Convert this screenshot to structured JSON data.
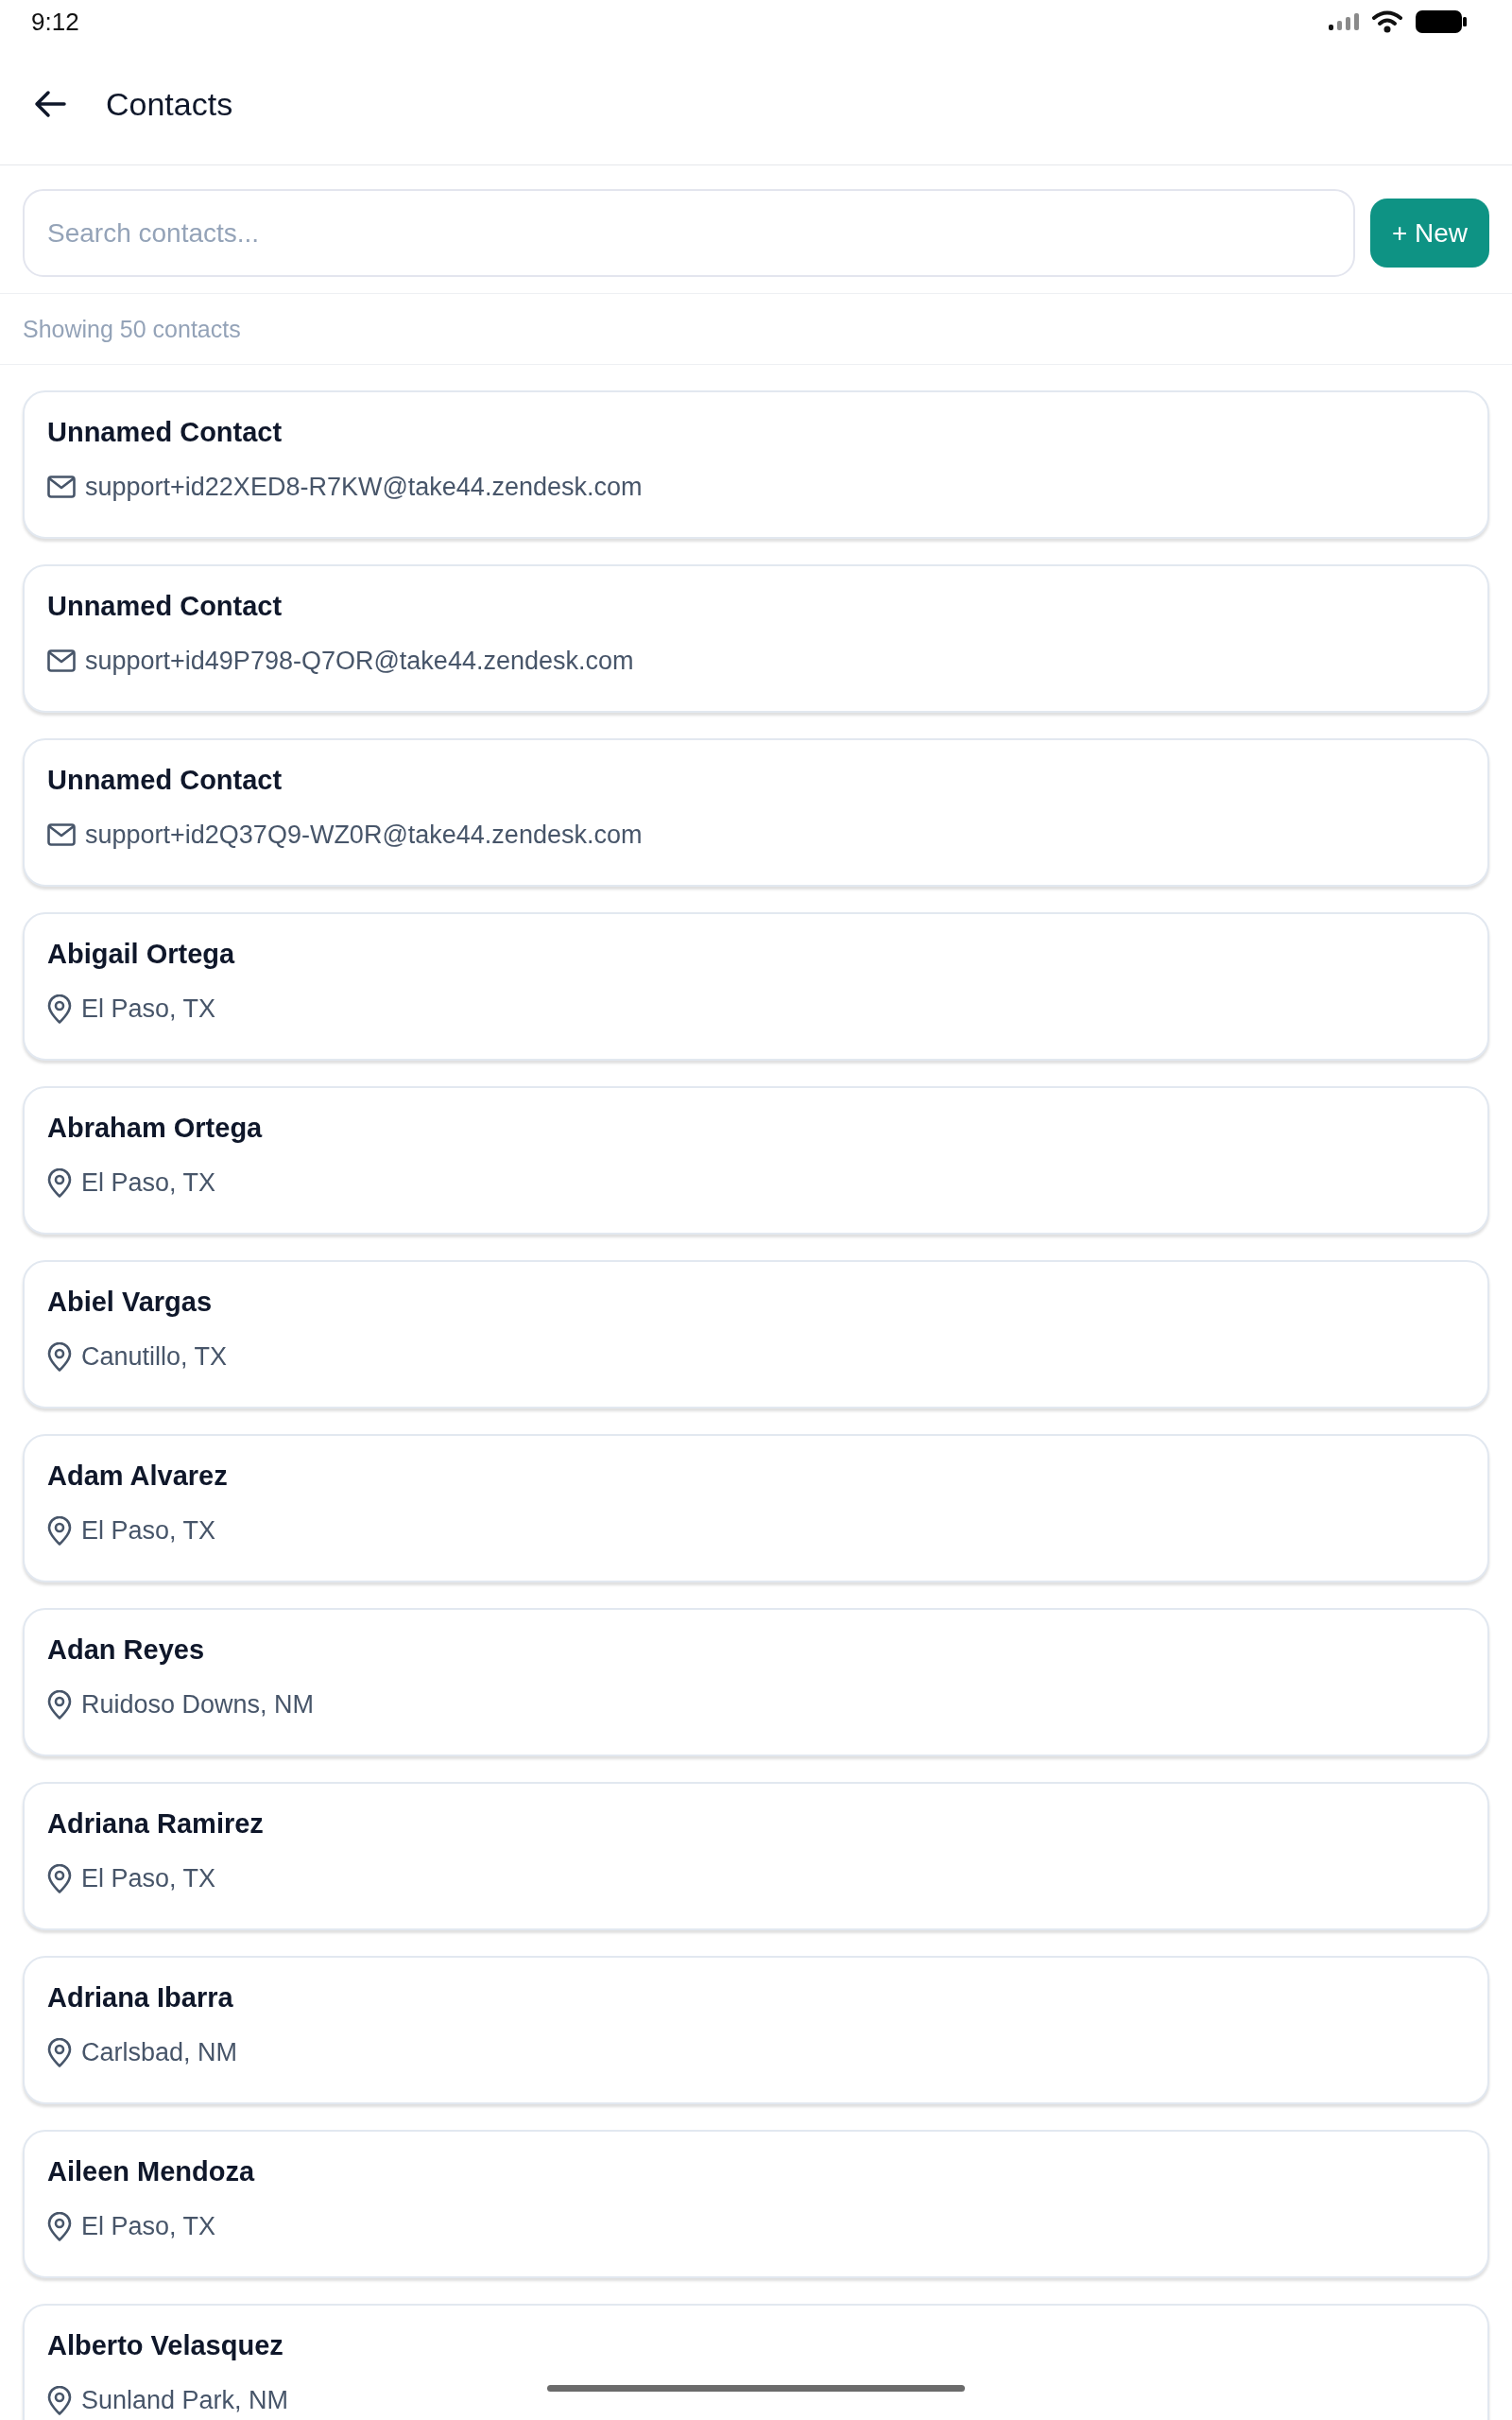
{
  "status_bar": {
    "time": "9:12"
  },
  "header": {
    "title": "Contacts"
  },
  "search": {
    "placeholder": "Search contacts..."
  },
  "new_button": {
    "label": "+ New"
  },
  "summary": "Showing 50 contacts",
  "contacts": [
    {
      "name": "Unnamed Contact",
      "kind": "email",
      "detail": "support+id22XED8-R7KW@take44.zendesk.com"
    },
    {
      "name": "Unnamed Contact",
      "kind": "email",
      "detail": "support+id49P798-Q7OR@take44.zendesk.com"
    },
    {
      "name": "Unnamed Contact",
      "kind": "email",
      "detail": "support+id2Q37Q9-WZ0R@take44.zendesk.com"
    },
    {
      "name": "Abigail Ortega",
      "kind": "location",
      "detail": "El Paso, TX"
    },
    {
      "name": "Abraham Ortega",
      "kind": "location",
      "detail": "El Paso, TX"
    },
    {
      "name": "Abiel Vargas",
      "kind": "location",
      "detail": "Canutillo, TX"
    },
    {
      "name": "Adam Alvarez",
      "kind": "location",
      "detail": "El Paso, TX"
    },
    {
      "name": "Adan Reyes",
      "kind": "location",
      "detail": "Ruidoso Downs, NM"
    },
    {
      "name": "Adriana Ramirez",
      "kind": "location",
      "detail": "El Paso, TX"
    },
    {
      "name": "Adriana Ibarra",
      "kind": "location",
      "detail": "Carlsbad, NM"
    },
    {
      "name": "Aileen Mendoza",
      "kind": "location",
      "detail": "El Paso, TX"
    },
    {
      "name": "Alberto Velasquez",
      "kind": "location",
      "detail": "Sunland Park, NM"
    }
  ]
}
